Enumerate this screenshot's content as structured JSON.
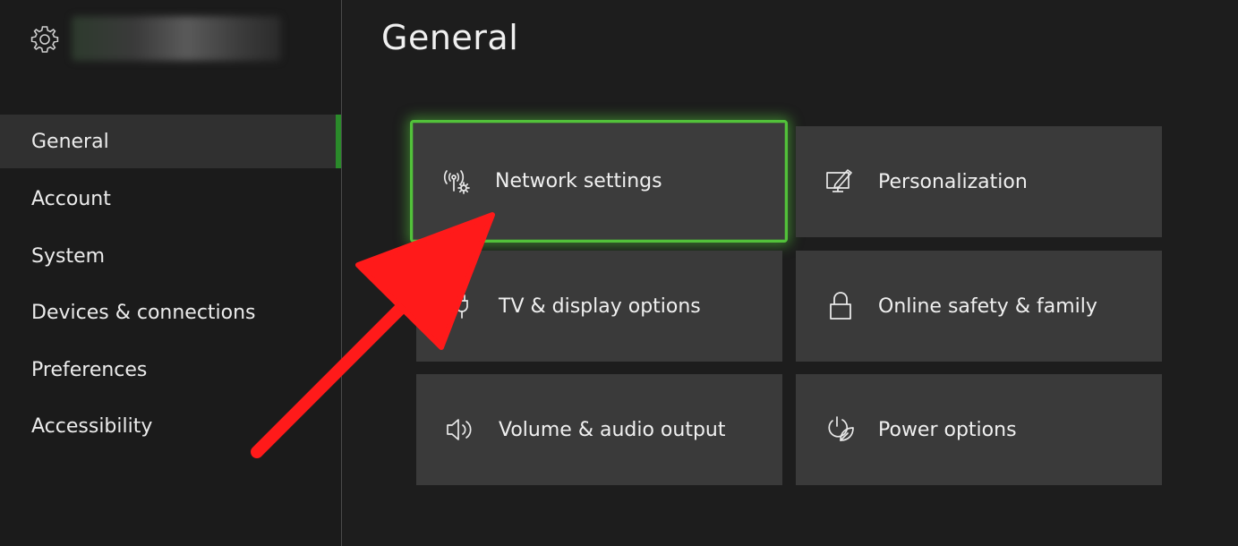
{
  "sidebar": {
    "settings_icon": "gear-icon",
    "items": [
      {
        "label": "General",
        "active": true
      },
      {
        "label": "Account"
      },
      {
        "label": "System"
      },
      {
        "label": "Devices & connections"
      },
      {
        "label": "Preferences"
      },
      {
        "label": "Accessibility"
      }
    ]
  },
  "main": {
    "title": "General",
    "tiles": [
      {
        "label": "Network settings",
        "icon": "network-settings-icon",
        "focused": true
      },
      {
        "label": "Personalization",
        "icon": "personalization-icon"
      },
      {
        "label": "TV & display options",
        "icon": "tv-display-icon"
      },
      {
        "label": "Online safety & family",
        "icon": "lock-icon"
      },
      {
        "label": "Volume & audio output",
        "icon": "speaker-icon"
      },
      {
        "label": "Power options",
        "icon": "power-leaf-icon"
      }
    ]
  },
  "colors": {
    "focus_accent": "#52c13a",
    "sidebar_accent": "#2a8a2a",
    "annotation_arrow": "#ff1a1a"
  }
}
